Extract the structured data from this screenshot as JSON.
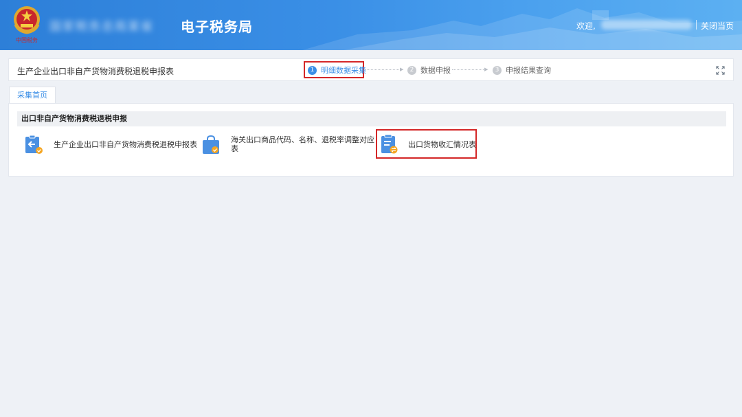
{
  "header": {
    "brand_blurred": "国家税务总局某省",
    "title": "电子税务局",
    "welcome": "欢迎,",
    "close_page": "关闭当页",
    "accent_color": "#3a8ee6",
    "highlight_color": "#d42727"
  },
  "toolbar": {
    "page_title": "生产企业出口非自产货物消费税退税申报表",
    "steps": [
      {
        "num": "1",
        "label": "明细数据采集",
        "active": true
      },
      {
        "num": "2",
        "label": "数据申报",
        "active": false
      },
      {
        "num": "3",
        "label": "申报结果查询",
        "active": false
      }
    ],
    "expand_icon": "expand-icon"
  },
  "tabs": [
    {
      "label": "采集首页",
      "active": true
    }
  ],
  "section": {
    "title": "出口非自产货物消费税退税申报",
    "items": [
      {
        "label": "生产企业出口非自产货物消费税退税申报表",
        "icon": "form-return-icon"
      },
      {
        "label_line1": "海关出口商品代码、名称、退税率调整对应",
        "label_line2": "表",
        "icon": "shopping-bag-check-icon"
      },
      {
        "label": "出口货物收汇情况表",
        "icon": "clipboard-exchange-icon",
        "highlighted": true
      }
    ]
  }
}
